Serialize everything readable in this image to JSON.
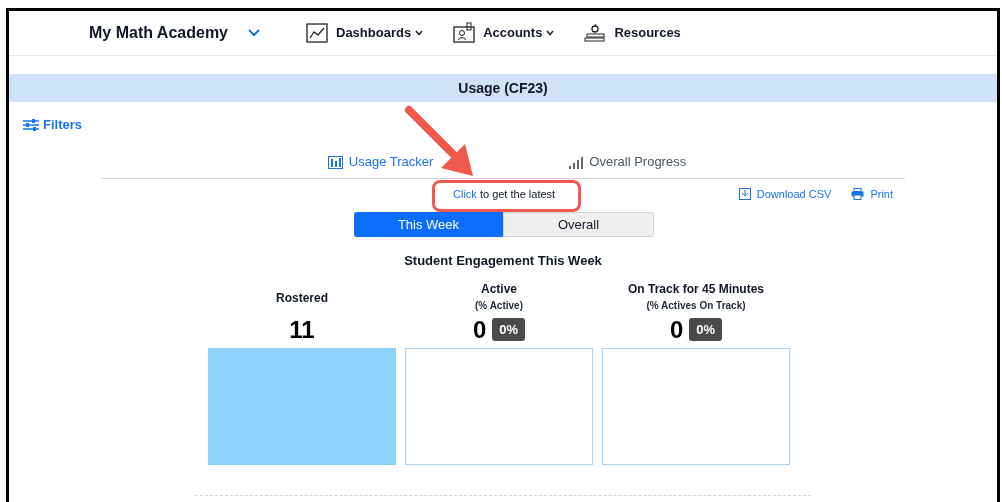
{
  "nav": {
    "brand": "My Math Academy",
    "items": [
      {
        "label": "Dashboards",
        "kind": "chart",
        "dropdown": true
      },
      {
        "label": "Accounts",
        "kind": "account",
        "dropdown": true
      },
      {
        "label": "Resources",
        "kind": "books",
        "dropdown": false
      }
    ]
  },
  "title_bar": "Usage (CF23)",
  "filters": "Filters",
  "tabs": [
    {
      "label": "Usage Tracker",
      "kind": "tracker",
      "selected": true
    },
    {
      "label": "Overall Progress",
      "kind": "progress",
      "selected": false
    }
  ],
  "refresh": {
    "link": "Click",
    "text": " to get the latest"
  },
  "actions": [
    {
      "label": "Download CSV",
      "kind": "download"
    },
    {
      "label": "Print",
      "kind": "print"
    }
  ],
  "toggle": [
    {
      "label": "This Week",
      "selected": true
    },
    {
      "label": "Overall",
      "selected": false
    }
  ],
  "engagement": {
    "title": "Student Engagement This Week",
    "metrics": [
      {
        "label": "Rostered",
        "count": "11",
        "filled": true
      },
      {
        "label": "Active",
        "sublabel": "(% Active)",
        "count": "0",
        "percent": "0%",
        "filled": false
      },
      {
        "label": "On Track for 45 Minutes",
        "sublabel": "(% Actives On Track)",
        "count": "0",
        "percent": "0%",
        "filled": false
      }
    ]
  }
}
